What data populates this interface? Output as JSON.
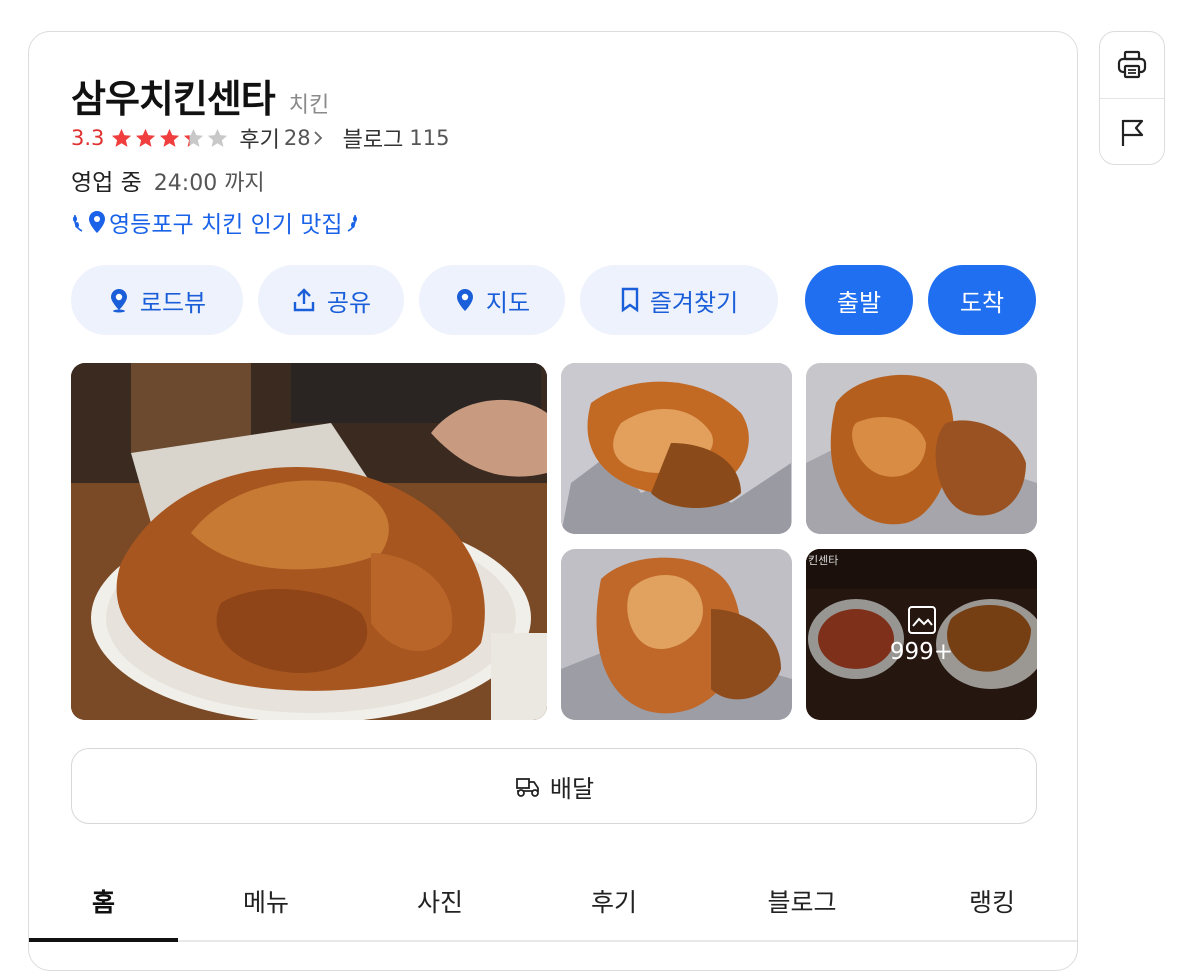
{
  "place": {
    "name": "삼우치킨센타",
    "category": "치킨",
    "rating": "3.3",
    "rating_value": 3.3,
    "reviews_label": "후기",
    "reviews_count": "28",
    "blog_label": "블로그",
    "blog_count": "115",
    "status": "영업 중",
    "hours": "24:00 까지",
    "badge": "영등포구 치킨 인기 맛집"
  },
  "actions": {
    "roadview": "로드뷰",
    "share": "공유",
    "map": "지도",
    "favorite": "즐겨찾기",
    "depart": "출발",
    "arrive": "도착"
  },
  "photos": {
    "more_count": "999+",
    "watermark": "킨센타"
  },
  "delivery_label": "배달",
  "tabs": [
    "홈",
    "메뉴",
    "사진",
    "후기",
    "블로그",
    "랭킹"
  ],
  "active_tab": "홈",
  "colors": {
    "accent": "#1f6ff0",
    "rating": "#e03131",
    "link": "#1a63e8",
    "pill_bg": "#eef2fc"
  }
}
